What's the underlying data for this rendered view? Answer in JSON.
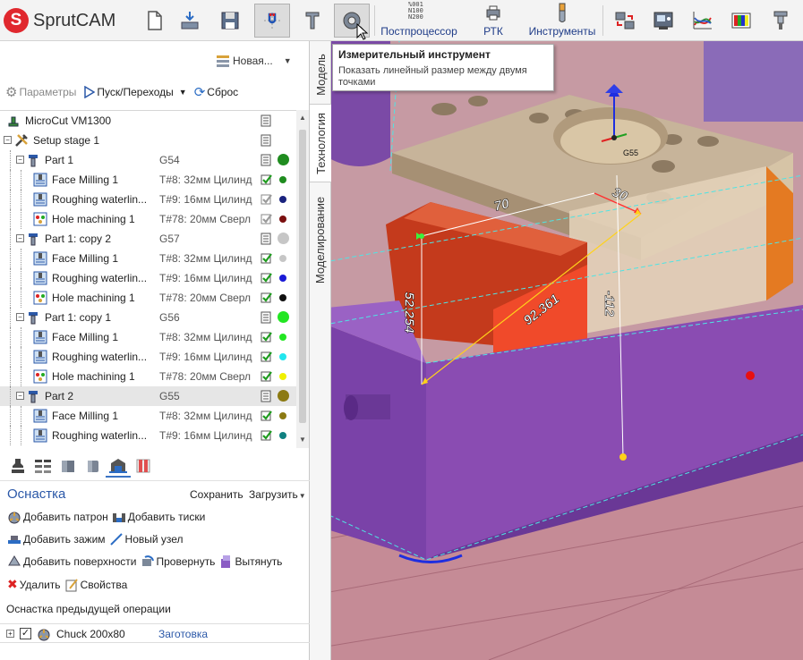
{
  "app": {
    "logo_letter": "S",
    "name": "SprutCAM"
  },
  "toolbar": {
    "postprocessor": "Постпроцессор",
    "postprocessor_glyph": "%001\nN100\nN200",
    "rtk": "РТК",
    "tools": "Инструменты"
  },
  "tooltip": {
    "title": "Измерительный инструмент",
    "text": "Показать линейный размер между двумя точками"
  },
  "left": {
    "mode": "Новая...",
    "params": "Параметры",
    "run": "Пуск/Переходы",
    "reset": "Сброс"
  },
  "tree": [
    {
      "level": 0,
      "type": "machine",
      "name": "MicroCut VM1300"
    },
    {
      "level": 0,
      "type": "setup",
      "name": "Setup stage 1",
      "expander": "−"
    },
    {
      "level": 1,
      "type": "part",
      "name": "Part 1",
      "g": "G54",
      "color": "#1f8c1f",
      "expander": "−"
    },
    {
      "level": 2,
      "type": "mill",
      "name": "Face Milling 1",
      "tool": "T#8: 32мм Цилинд",
      "color": "#1f8c1f",
      "status": "check"
    },
    {
      "level": 2,
      "type": "mill",
      "name": "Roughing waterlin...",
      "tool": "T#9: 16мм Цилинд",
      "color": "#1a237e",
      "status": "gray"
    },
    {
      "level": 2,
      "type": "hole",
      "name": "Hole machining 1",
      "tool": "T#78: 20мм Сверл",
      "color": "#7b1010",
      "status": "gray"
    },
    {
      "level": 1,
      "type": "part",
      "name": "Part 1: copy 2",
      "g": "G57",
      "color": "#c6c6c6",
      "expander": "−"
    },
    {
      "level": 2,
      "type": "mill",
      "name": "Face Milling 1",
      "tool": "T#8: 32мм Цилинд",
      "color": "#c6c6c6",
      "status": "check"
    },
    {
      "level": 2,
      "type": "mill",
      "name": "Roughing waterlin...",
      "tool": "T#9: 16мм Цилинд",
      "color": "#1a1ad6",
      "status": "check"
    },
    {
      "level": 2,
      "type": "hole",
      "name": "Hole machining 1",
      "tool": "T#78: 20мм Сверл",
      "color": "#101010",
      "status": "check"
    },
    {
      "level": 1,
      "type": "part",
      "name": "Part 1: copy 1",
      "g": "G56",
      "color": "#22e622",
      "expander": "−"
    },
    {
      "level": 2,
      "type": "mill",
      "name": "Face Milling 1",
      "tool": "T#8: 32мм Цилинд",
      "color": "#22e622",
      "status": "check"
    },
    {
      "level": 2,
      "type": "mill",
      "name": "Roughing waterlin...",
      "tool": "T#9: 16мм Цилинд",
      "color": "#22e6ee",
      "status": "check"
    },
    {
      "level": 2,
      "type": "hole",
      "name": "Hole machining 1",
      "tool": "T#78: 20мм Сверл",
      "color": "#f0f000",
      "status": "check"
    },
    {
      "level": 1,
      "type": "part",
      "name": "Part 2",
      "g": "G55",
      "color": "#8c7a12",
      "expander": "−",
      "selected": true
    },
    {
      "level": 2,
      "type": "mill",
      "name": "Face Milling 1",
      "tool": "T#8: 32мм Цилинд",
      "color": "#8c7a12",
      "status": "check"
    },
    {
      "level": 2,
      "type": "mill",
      "name": "Roughing waterlin...",
      "tool": "T#9: 16мм Цилинд",
      "color": "#108080",
      "status": "check"
    }
  ],
  "fixture": {
    "title": "Оснастка",
    "save": "Сохранить",
    "load": "Загрузить",
    "add_chuck": "Добавить патрон",
    "add_vise": "Добавить тиски",
    "add_clamp": "Добавить зажим",
    "new_node": "Новый узел",
    "add_surfaces": "Добавить поверхности",
    "rotate": "Провернуть",
    "extrude": "Вытянуть",
    "delete": "Удалить",
    "properties": "Свойства",
    "prev_op": "Оснастка предыдущей операции",
    "chuck_name": "Chuck 200x80",
    "chuck_link": "Заготовка"
  },
  "side_tabs": {
    "model": "Модель",
    "technology": "Технология",
    "modeling": "Моделирование"
  },
  "viewport": {
    "dim_70": "70",
    "dim_30": "30",
    "dim_52": "52.254",
    "dim_92": "92.361",
    "dim_112": "-112",
    "g55": "G55"
  },
  "colors": {
    "accent": "#2b58a8",
    "purple": "#8a4cb2",
    "red_part": "#e24a2a",
    "tan": "#d8c7a8",
    "bg_floor": "#c8909a"
  }
}
